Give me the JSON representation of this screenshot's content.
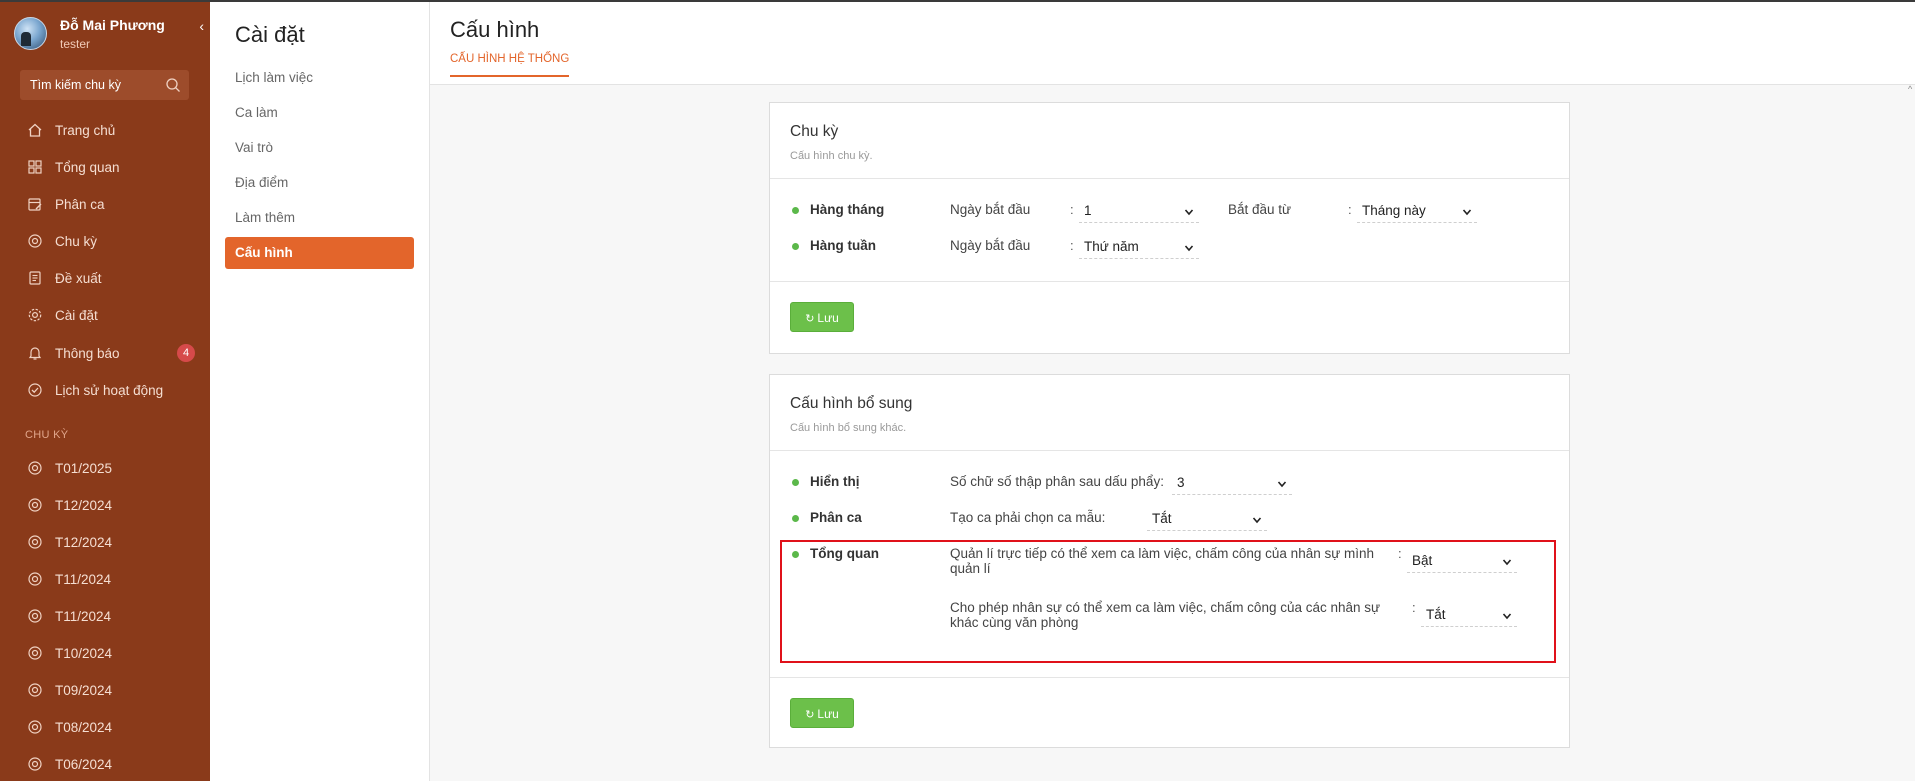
{
  "user": {
    "name": "Đỗ Mai Phương",
    "role": "tester"
  },
  "search": {
    "placeholder": "Tìm kiếm chu kỳ"
  },
  "nav": [
    {
      "label": "Trang chủ",
      "icon": "home-icon"
    },
    {
      "label": "Tổng quan",
      "icon": "grid-icon"
    },
    {
      "label": "Phân ca",
      "icon": "calendar-edit-icon"
    },
    {
      "label": "Chu kỳ",
      "icon": "cycle-icon"
    },
    {
      "label": "Đề xuất",
      "icon": "document-icon"
    },
    {
      "label": "Cài đặt",
      "icon": "gear-icon"
    },
    {
      "label": "Thông báo",
      "icon": "bell-icon",
      "badge": "4"
    },
    {
      "label": "Lịch sử hoạt động",
      "icon": "history-check-icon"
    }
  ],
  "cycles_section": "CHU KỲ",
  "cycles": [
    "T01/2025",
    "T12/2024",
    "T12/2024",
    "T11/2024",
    "T11/2024",
    "T10/2024",
    "T09/2024",
    "T08/2024",
    "T06/2024"
  ],
  "settings": {
    "title": "Cài đặt",
    "items": [
      "Lịch làm việc",
      "Ca làm",
      "Vai trò",
      "Địa điểm",
      "Làm thêm",
      "Cấu hình"
    ],
    "active": "Cấu hình"
  },
  "page": {
    "title": "Cấu hình",
    "tab": "CẤU HÌNH HỆ THỐNG"
  },
  "cycle_card": {
    "title": "Chu kỳ",
    "subtitle": "Cấu hình chu kỳ.",
    "monthly": {
      "name": "Hàng tháng",
      "start_label": "Ngày bắt đầu",
      "start_value": "1",
      "from_label": "Bắt đầu từ",
      "from_value": "Tháng này"
    },
    "weekly": {
      "name": "Hàng tuần",
      "start_label": "Ngày bắt đầu",
      "start_value": "Thứ năm"
    },
    "save": "Lưu"
  },
  "extra_card": {
    "title": "Cấu hình bổ sung",
    "subtitle": "Cấu hình bổ sung khác.",
    "display": {
      "name": "Hiển thị",
      "label": "Số chữ số thập phân sau dấu phẩy:",
      "value": "3"
    },
    "shift": {
      "name": "Phân ca",
      "label": "Tạo ca phải chọn ca mẫu:",
      "value": "Tắt"
    },
    "overview": {
      "name": "Tổng quan",
      "opt1_line1": "Quản lí trực tiếp có thể xem ca làm việc, chấm công của nhân sự mình",
      "opt1_line2": "quản lí",
      "opt1_value": "Bật",
      "opt2_line1": "Cho phép nhân sự có thể xem ca làm việc, chấm công của các nhân sự",
      "opt2_line2": "khác cùng văn phòng",
      "opt2_value": "Tắt"
    },
    "save": "Lưu"
  },
  "colors": {
    "sidebar": "#8a3a1a",
    "accent": "#e3652b",
    "save": "#6cc04a",
    "highlight": "#e0111a"
  }
}
